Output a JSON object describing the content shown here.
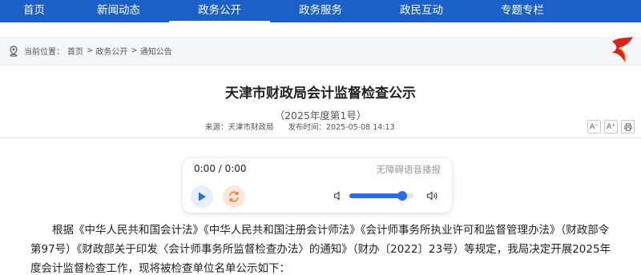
{
  "nav": {
    "items": [
      {
        "label": "首页"
      },
      {
        "label": "新闻动态"
      },
      {
        "label": "政务公开"
      },
      {
        "label": "政务服务"
      },
      {
        "label": "政民互动"
      },
      {
        "label": "专题专栏"
      }
    ],
    "active_index": 2
  },
  "breadcrumb": {
    "prefix": "当前位置：",
    "items": [
      "首页",
      "政务公开",
      "通知公告"
    ],
    "separator": ">"
  },
  "article": {
    "title": "天津市财政局会计监督检查公示",
    "subtitle": "（2025年度第1号）",
    "source": "来源：天津市财政局",
    "published": "发布时间：2025-05-08 14:13",
    "tools": [
      "A⁻",
      "A⁺",
      "print"
    ],
    "body": "根据《中华人民共和国会计法》《中华人民共和国注册会计师法》《会计师事务所执业许可和监督管理办法》（财政部令第97号）《财政部关于印发〈会计师事务所监督检查办法〉的通知》（财办〔2022〕23号）等规定，我局决定开展2025年度会计监督检查工作，现将被检查单位名单公示如下："
  },
  "player": {
    "time": "0:00 / 0:00",
    "assist_label": "无障碍语音播报",
    "volume_fraction": 0.82
  },
  "colors": {
    "nav_bg": "#1a60c8",
    "accent": "#2a6be8",
    "loop": "#f07a3a"
  }
}
